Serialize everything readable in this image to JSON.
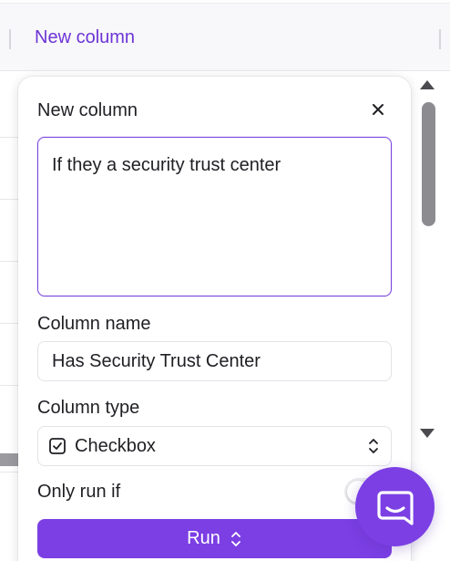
{
  "table": {
    "header_column_label": "New column"
  },
  "panel": {
    "title": "New column",
    "close_icon": "close-icon",
    "prompt_value": "If they a security trust center",
    "column_name_label": "Column name",
    "column_name_value": "Has Security Trust Center",
    "column_type_label": "Column type",
    "column_type_value": "Checkbox",
    "column_type_icon": "checkbox-icon",
    "only_run_if_label": "Only run if",
    "only_run_if_enabled": false,
    "run_label": "Run"
  },
  "chat": {
    "icon": "chat-icon"
  },
  "colors": {
    "accent": "#7b3fe4",
    "header_text": "#6d35d6",
    "text": "#1f1f24"
  }
}
